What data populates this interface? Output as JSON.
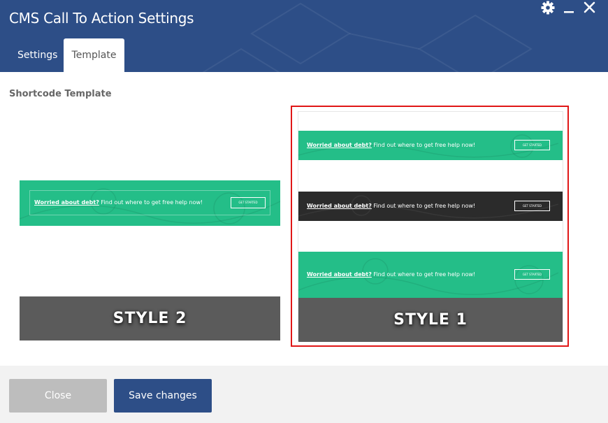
{
  "window": {
    "title": "CMS Call To Action Settings",
    "icons": [
      "gear-icon",
      "minimize-icon",
      "close-icon"
    ]
  },
  "tabs": [
    {
      "label": "Settings",
      "active": false
    },
    {
      "label": "Template",
      "active": true
    }
  ],
  "section": {
    "label": "Shortcode Template"
  },
  "templates": [
    {
      "style_label": "STYLE 2",
      "selected": false,
      "banners": [
        {
          "variant": "green",
          "headline": "Worried about debt?",
          "text": "Find out where to get free help now!",
          "button": "GET STARTED"
        }
      ]
    },
    {
      "style_label": "STYLE 1",
      "selected": true,
      "banners": [
        {
          "variant": "green",
          "headline": "Worried about debt?",
          "text": "Find out where to get free help now!",
          "button": "GET STARTED"
        },
        {
          "variant": "dark",
          "headline": "Worried about debt?",
          "text": "Find out where to get free help now!",
          "button": "GET STARTED"
        },
        {
          "variant": "green",
          "headline": "Worried about debt?",
          "text": "Find out where to get free help now!",
          "button": "GET STARTED"
        }
      ]
    }
  ],
  "footer": {
    "close_label": "Close",
    "save_label": "Save changes"
  },
  "colors": {
    "header": "#2d4e87",
    "banner_green": "#24be88",
    "banner_dark": "#2b2b2b",
    "selected_border": "#e01616",
    "style_bar": "#5b5b5b"
  }
}
